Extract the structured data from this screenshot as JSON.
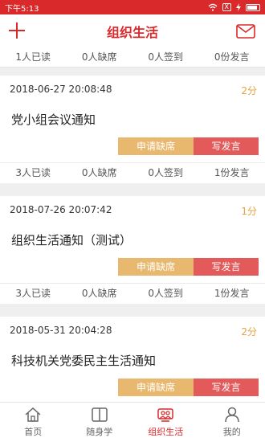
{
  "status_bar": {
    "time": "下午5:13",
    "x_badge": "X"
  },
  "header": {
    "title": "组织生活",
    "left_icon": "plus-icon",
    "right_icon": "mail-icon"
  },
  "summary": {
    "read": "1人已读",
    "absent": "0人缺席",
    "signed": "0人签到",
    "speeches": "0份发言"
  },
  "cards": [
    {
      "datetime": "2018-06-27 20:08:48",
      "score": "2分",
      "title": "党小组会议通知",
      "leave_label": "申请缺席",
      "speech_label": "写发言",
      "read": "3人已读",
      "absent": "0人缺席",
      "signed": "0人签到",
      "speeches": "1份发言"
    },
    {
      "datetime": "2018-07-26 20:07:42",
      "score": "1分",
      "title": "组织生活通知（测试）",
      "leave_label": "申请缺席",
      "speech_label": "写发言",
      "read": "3人已读",
      "absent": "0人缺席",
      "signed": "0人签到",
      "speeches": "1份发言"
    },
    {
      "datetime": "2018-05-31 20:04:28",
      "score": "2分",
      "title": "科技机关党委民主生活通知",
      "leave_label": "申请缺席",
      "speech_label": "写发言"
    }
  ],
  "nav": {
    "items": [
      {
        "label": "首页",
        "icon": "home-icon"
      },
      {
        "label": "随身学",
        "icon": "book-icon"
      },
      {
        "label": "组织生活",
        "icon": "group-icon"
      },
      {
        "label": "我的",
        "icon": "user-icon"
      }
    ],
    "active_index": 2
  },
  "colors": {
    "brand_red": "#d9292a",
    "leave_button": "#e8b86e",
    "speech_button": "#e35a5a",
    "score_orange": "#e4a23c"
  }
}
